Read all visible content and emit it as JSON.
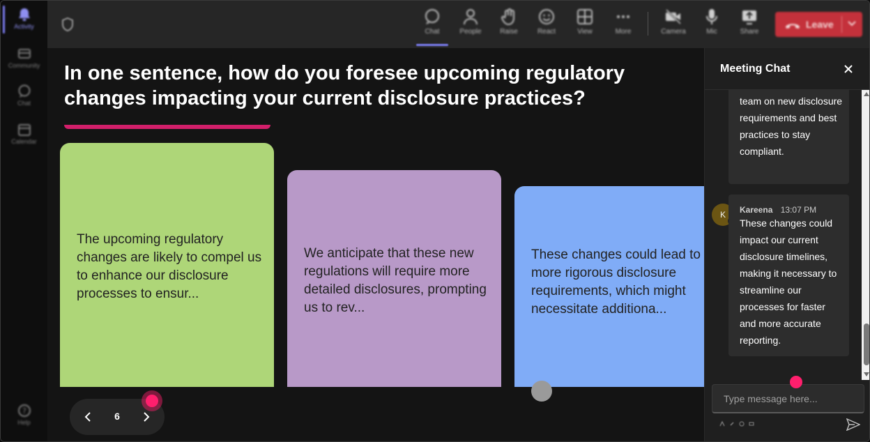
{
  "rail": {
    "items": [
      {
        "label": "Activity",
        "icon": "bell-icon"
      },
      {
        "label": "Community",
        "icon": "community-icon"
      },
      {
        "label": "Chat",
        "icon": "chat-icon"
      },
      {
        "label": "Calendar",
        "icon": "calendar-icon"
      }
    ],
    "help": "Help"
  },
  "toolbar": {
    "chat": "Chat",
    "people": "People",
    "raise": "Raise",
    "react": "React",
    "view": "View",
    "more": "More",
    "camera": "Camera",
    "mic": "Mic",
    "share": "Share",
    "leave": "Leave"
  },
  "stage": {
    "question_line1": "In one sentence, how do you foresee upcoming regulatory",
    "question_line2": "changes impacting your current disclosure practices?",
    "cards": [
      {
        "text": "The upcoming regulatory changes are likely to compel us to enhance our disclosure processes to ensur...",
        "color": "#aed678"
      },
      {
        "text": "We anticipate that these new regulations will require more detailed disclosures, prompting us to rev...",
        "color": "#b899c8"
      },
      {
        "text_lines": [
          "These changes could lead to",
          "more rigorous disclosure",
          "requirements, which might",
          "necessitate additiona..."
        ],
        "color": "#80acf7"
      }
    ],
    "page_number": "6"
  },
  "chat": {
    "title": "Meeting Chat",
    "messages": [
      {
        "text": "team on new disclosure requirements and best practices to stay compliant."
      },
      {
        "author": "Kareena",
        "initial": "K",
        "time": "13:07 PM",
        "text": "These changes could impact our current disclosure timelines, making it necessary to streamline our processes for faster and more accurate reporting."
      }
    ],
    "input_placeholder": "Type message here..."
  },
  "colors": {
    "accent": "#7b7cf0",
    "leave": "#c4313b",
    "pink_marker": "#ff1f6d"
  }
}
